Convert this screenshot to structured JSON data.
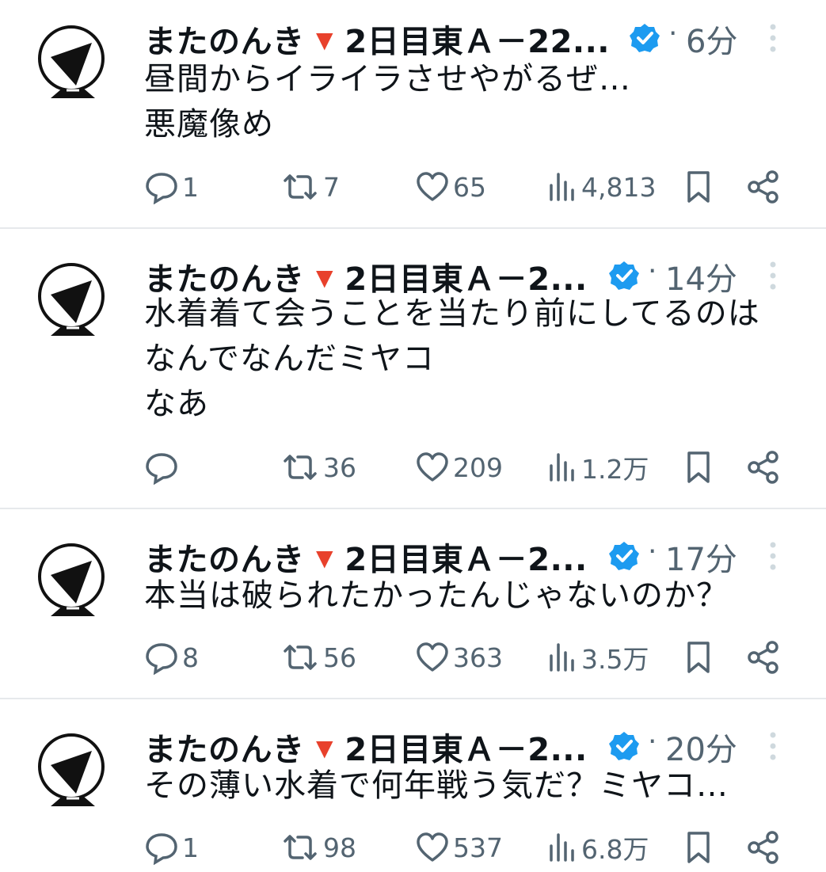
{
  "author": {
    "name": "またのんき",
    "handle_suffix": "2日目東Ａ－22...",
    "handle_suffix_short": "2日目東Ａ－2...",
    "accent_color": "#1d9bf0",
    "marker_color": "#e8412c"
  },
  "icons": {
    "verified": "verified-badge-icon",
    "reply": "reply-icon",
    "retweet": "retweet-icon",
    "like": "heart-icon",
    "views": "views-icon",
    "bookmark": "bookmark-icon",
    "share": "share-icon",
    "more": "more-vertical-icon"
  },
  "tweets": [
    {
      "time": "6分",
      "lines": [
        "昼間からイライラさせやがるぜ…",
        "悪魔像め"
      ],
      "replies": "1",
      "retweets": "7",
      "likes": "65",
      "views": "4,813"
    },
    {
      "time": "14分",
      "lines": [
        "水着着て会うことを当たり前にしてるのは",
        "なんでなんだミヤコ",
        "なあ"
      ],
      "replies": "",
      "retweets": "36",
      "likes": "209",
      "views": "1.2万"
    },
    {
      "time": "17分",
      "lines": [
        "本当は破られたかったんじゃないのか？"
      ],
      "replies": "8",
      "retweets": "56",
      "likes": "363",
      "views": "3.5万"
    },
    {
      "time": "20分",
      "lines": [
        "その薄い水着で何年戦う気だ？ミヤコ…"
      ],
      "replies": "1",
      "retweets": "98",
      "likes": "537",
      "views": "6.8万"
    }
  ]
}
